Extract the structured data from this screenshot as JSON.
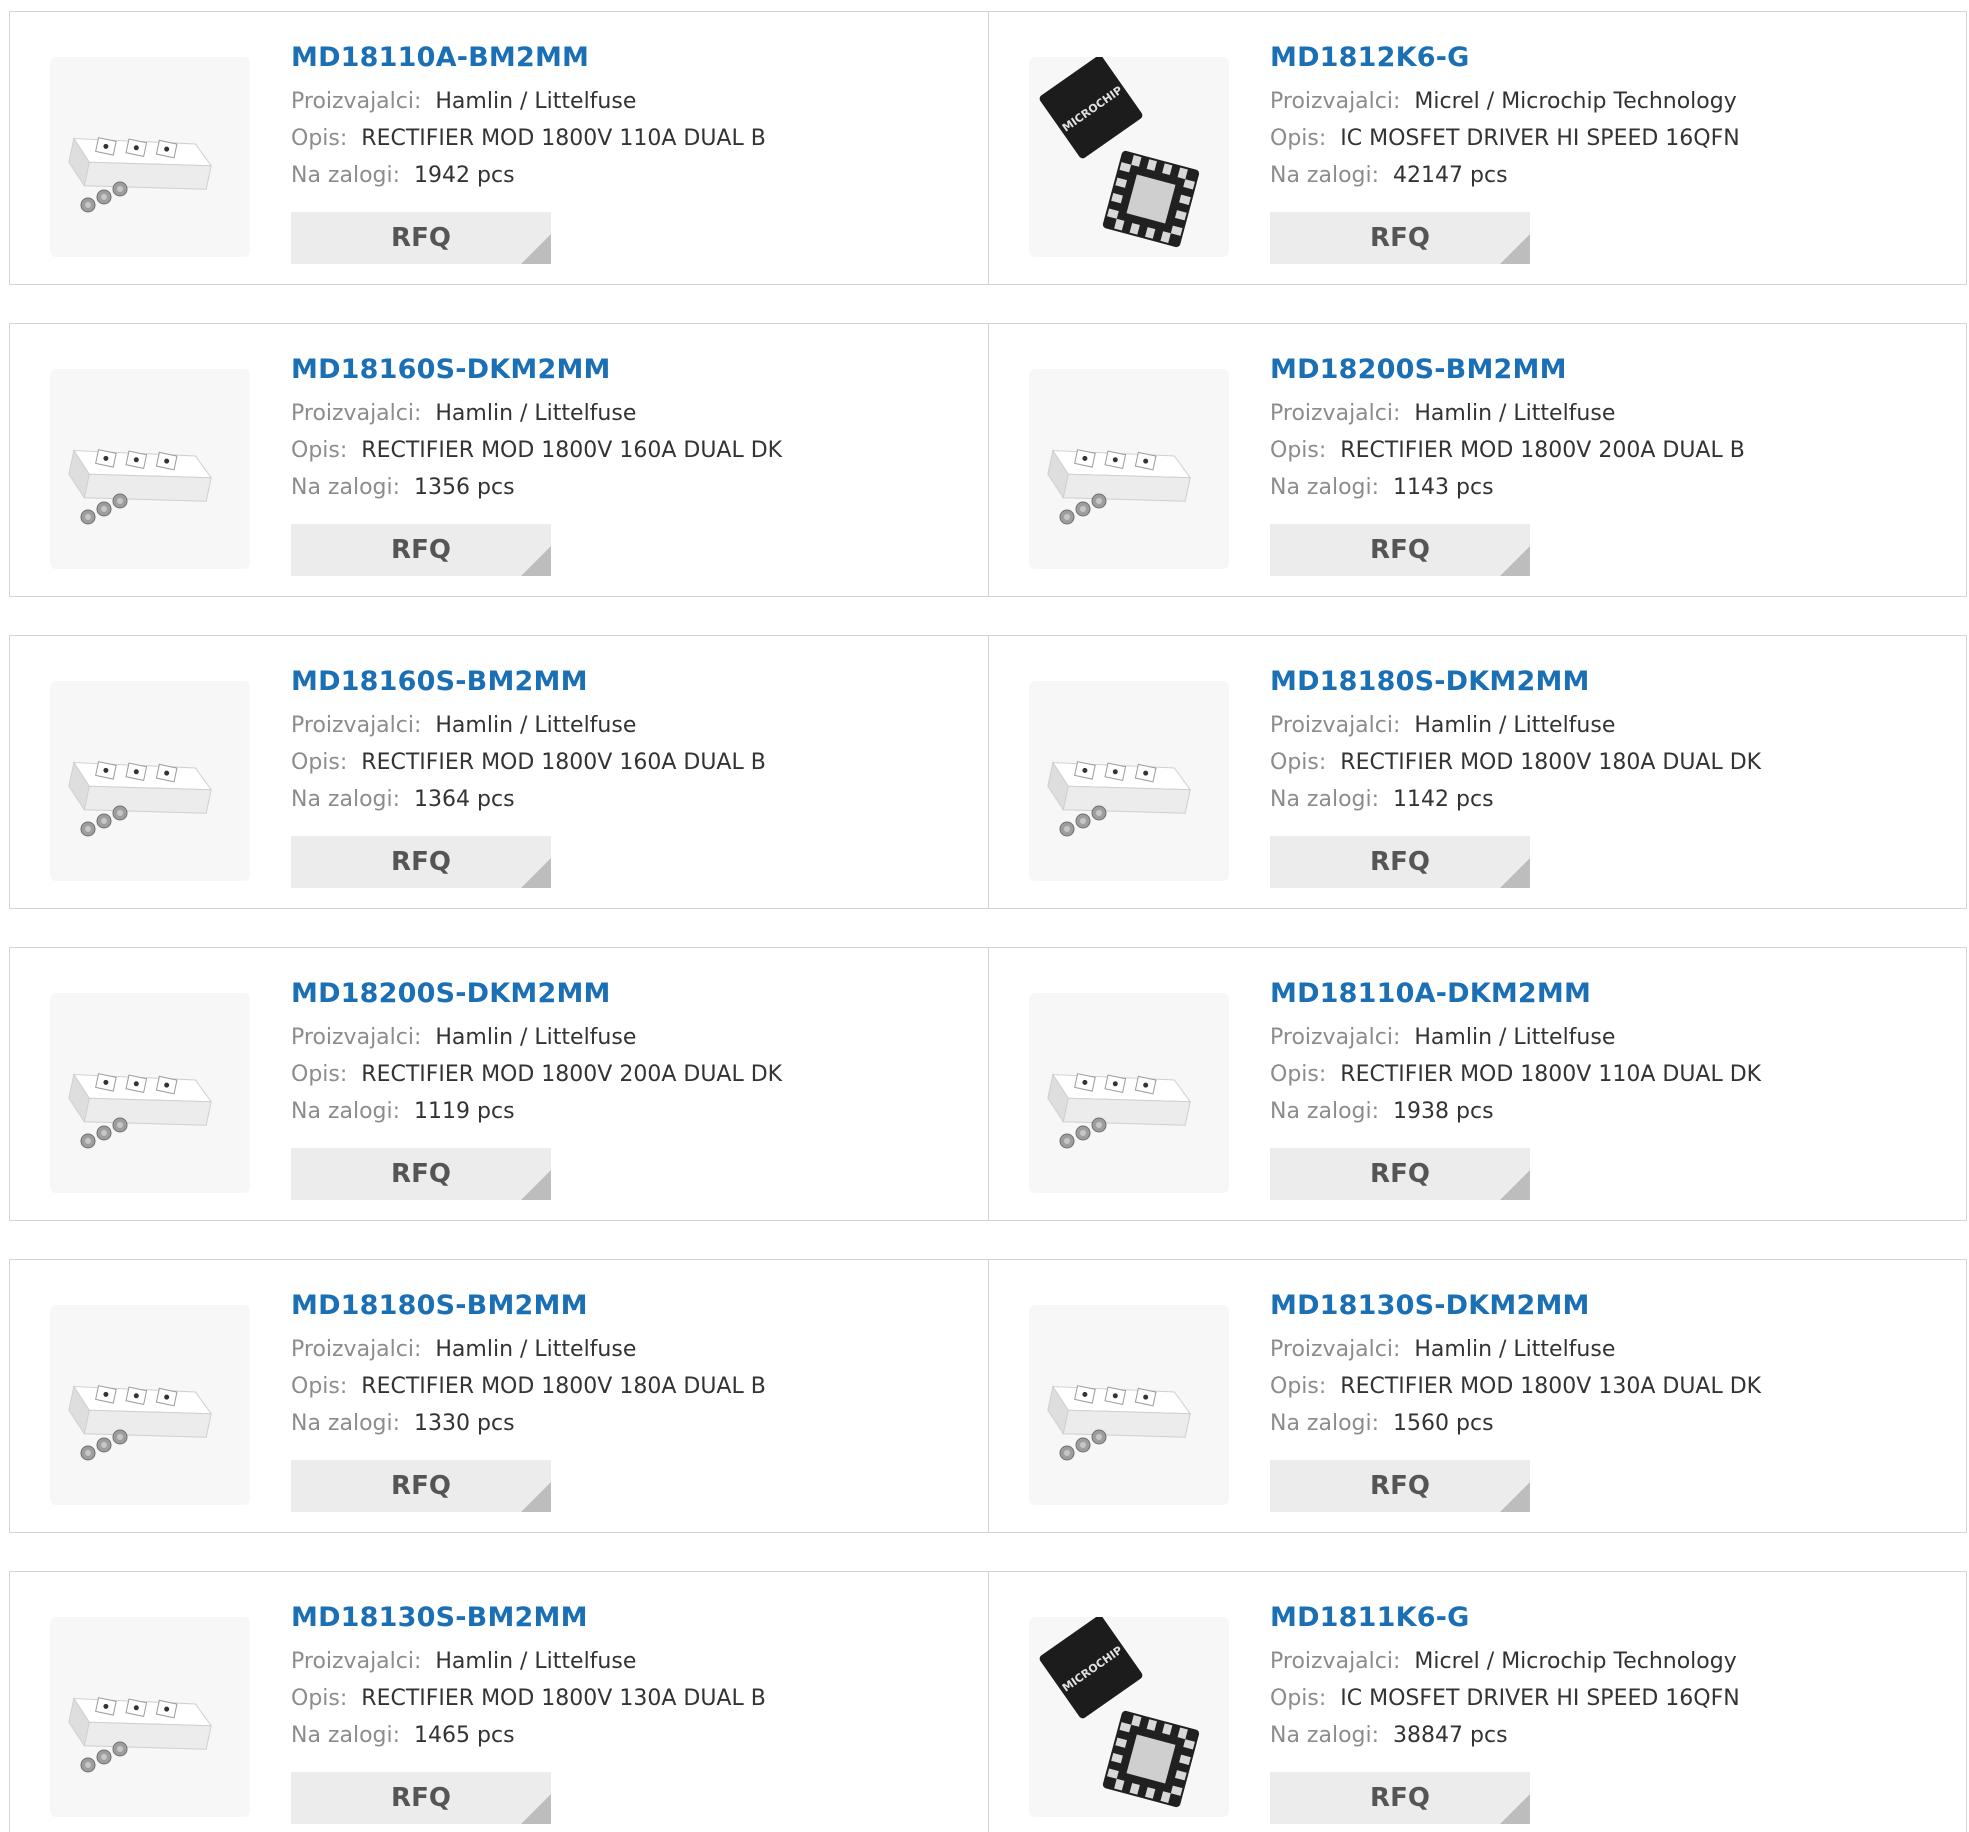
{
  "labels": {
    "manufacturer": "Proizvajalci:",
    "description": "Opis:",
    "stock": "Na zalogi:",
    "rfq": "RFQ"
  },
  "colors": {
    "part_link": "#1a6fb5",
    "label": "#8c8c8c",
    "border": "#d4d4d4",
    "button": "#ececec"
  },
  "products": [
    {
      "part": "MD18110A-BM2MM",
      "manufacturer": "Hamlin / Littelfuse",
      "description": "RECTIFIER MOD 1800V 110A DUAL B",
      "stock": "1942 pcs",
      "image": "module-icon"
    },
    {
      "part": "MD1812K6-G",
      "manufacturer": "Micrel / Microchip Technology",
      "description": "IC MOSFET DRIVER HI SPEED 16QFN",
      "stock": "42147 pcs",
      "image": "chip-icon"
    },
    {
      "part": "MD18160S-DKM2MM",
      "manufacturer": "Hamlin / Littelfuse",
      "description": "RECTIFIER MOD 1800V 160A DUAL DK",
      "stock": "1356 pcs",
      "image": "module-icon"
    },
    {
      "part": "MD18200S-BM2MM",
      "manufacturer": "Hamlin / Littelfuse",
      "description": "RECTIFIER MOD 1800V 200A DUAL B",
      "stock": "1143 pcs",
      "image": "module-icon"
    },
    {
      "part": "MD18160S-BM2MM",
      "manufacturer": "Hamlin / Littelfuse",
      "description": "RECTIFIER MOD 1800V 160A DUAL B",
      "stock": "1364 pcs",
      "image": "module-icon"
    },
    {
      "part": "MD18180S-DKM2MM",
      "manufacturer": "Hamlin / Littelfuse",
      "description": "RECTIFIER MOD 1800V 180A DUAL DK",
      "stock": "1142 pcs",
      "image": "module-icon"
    },
    {
      "part": "MD18200S-DKM2MM",
      "manufacturer": "Hamlin / Littelfuse",
      "description": "RECTIFIER MOD 1800V 200A DUAL DK",
      "stock": "1119 pcs",
      "image": "module-icon"
    },
    {
      "part": "MD18110A-DKM2MM",
      "manufacturer": "Hamlin / Littelfuse",
      "description": "RECTIFIER MOD 1800V 110A DUAL DK",
      "stock": "1938 pcs",
      "image": "module-icon"
    },
    {
      "part": "MD18180S-BM2MM",
      "manufacturer": "Hamlin / Littelfuse",
      "description": "RECTIFIER MOD 1800V 180A DUAL B",
      "stock": "1330 pcs",
      "image": "module-icon"
    },
    {
      "part": "MD18130S-DKM2MM",
      "manufacturer": "Hamlin / Littelfuse",
      "description": "RECTIFIER MOD 1800V 130A DUAL DK",
      "stock": "1560 pcs",
      "image": "module-icon"
    },
    {
      "part": "MD18130S-BM2MM",
      "manufacturer": "Hamlin / Littelfuse",
      "description": "RECTIFIER MOD 1800V 130A DUAL B",
      "stock": "1465 pcs",
      "image": "module-icon"
    },
    {
      "part": "MD1811K6-G",
      "manufacturer": "Micrel / Microchip Technology",
      "description": "IC MOSFET DRIVER HI SPEED 16QFN",
      "stock": "38847 pcs",
      "image": "chip-icon"
    }
  ]
}
